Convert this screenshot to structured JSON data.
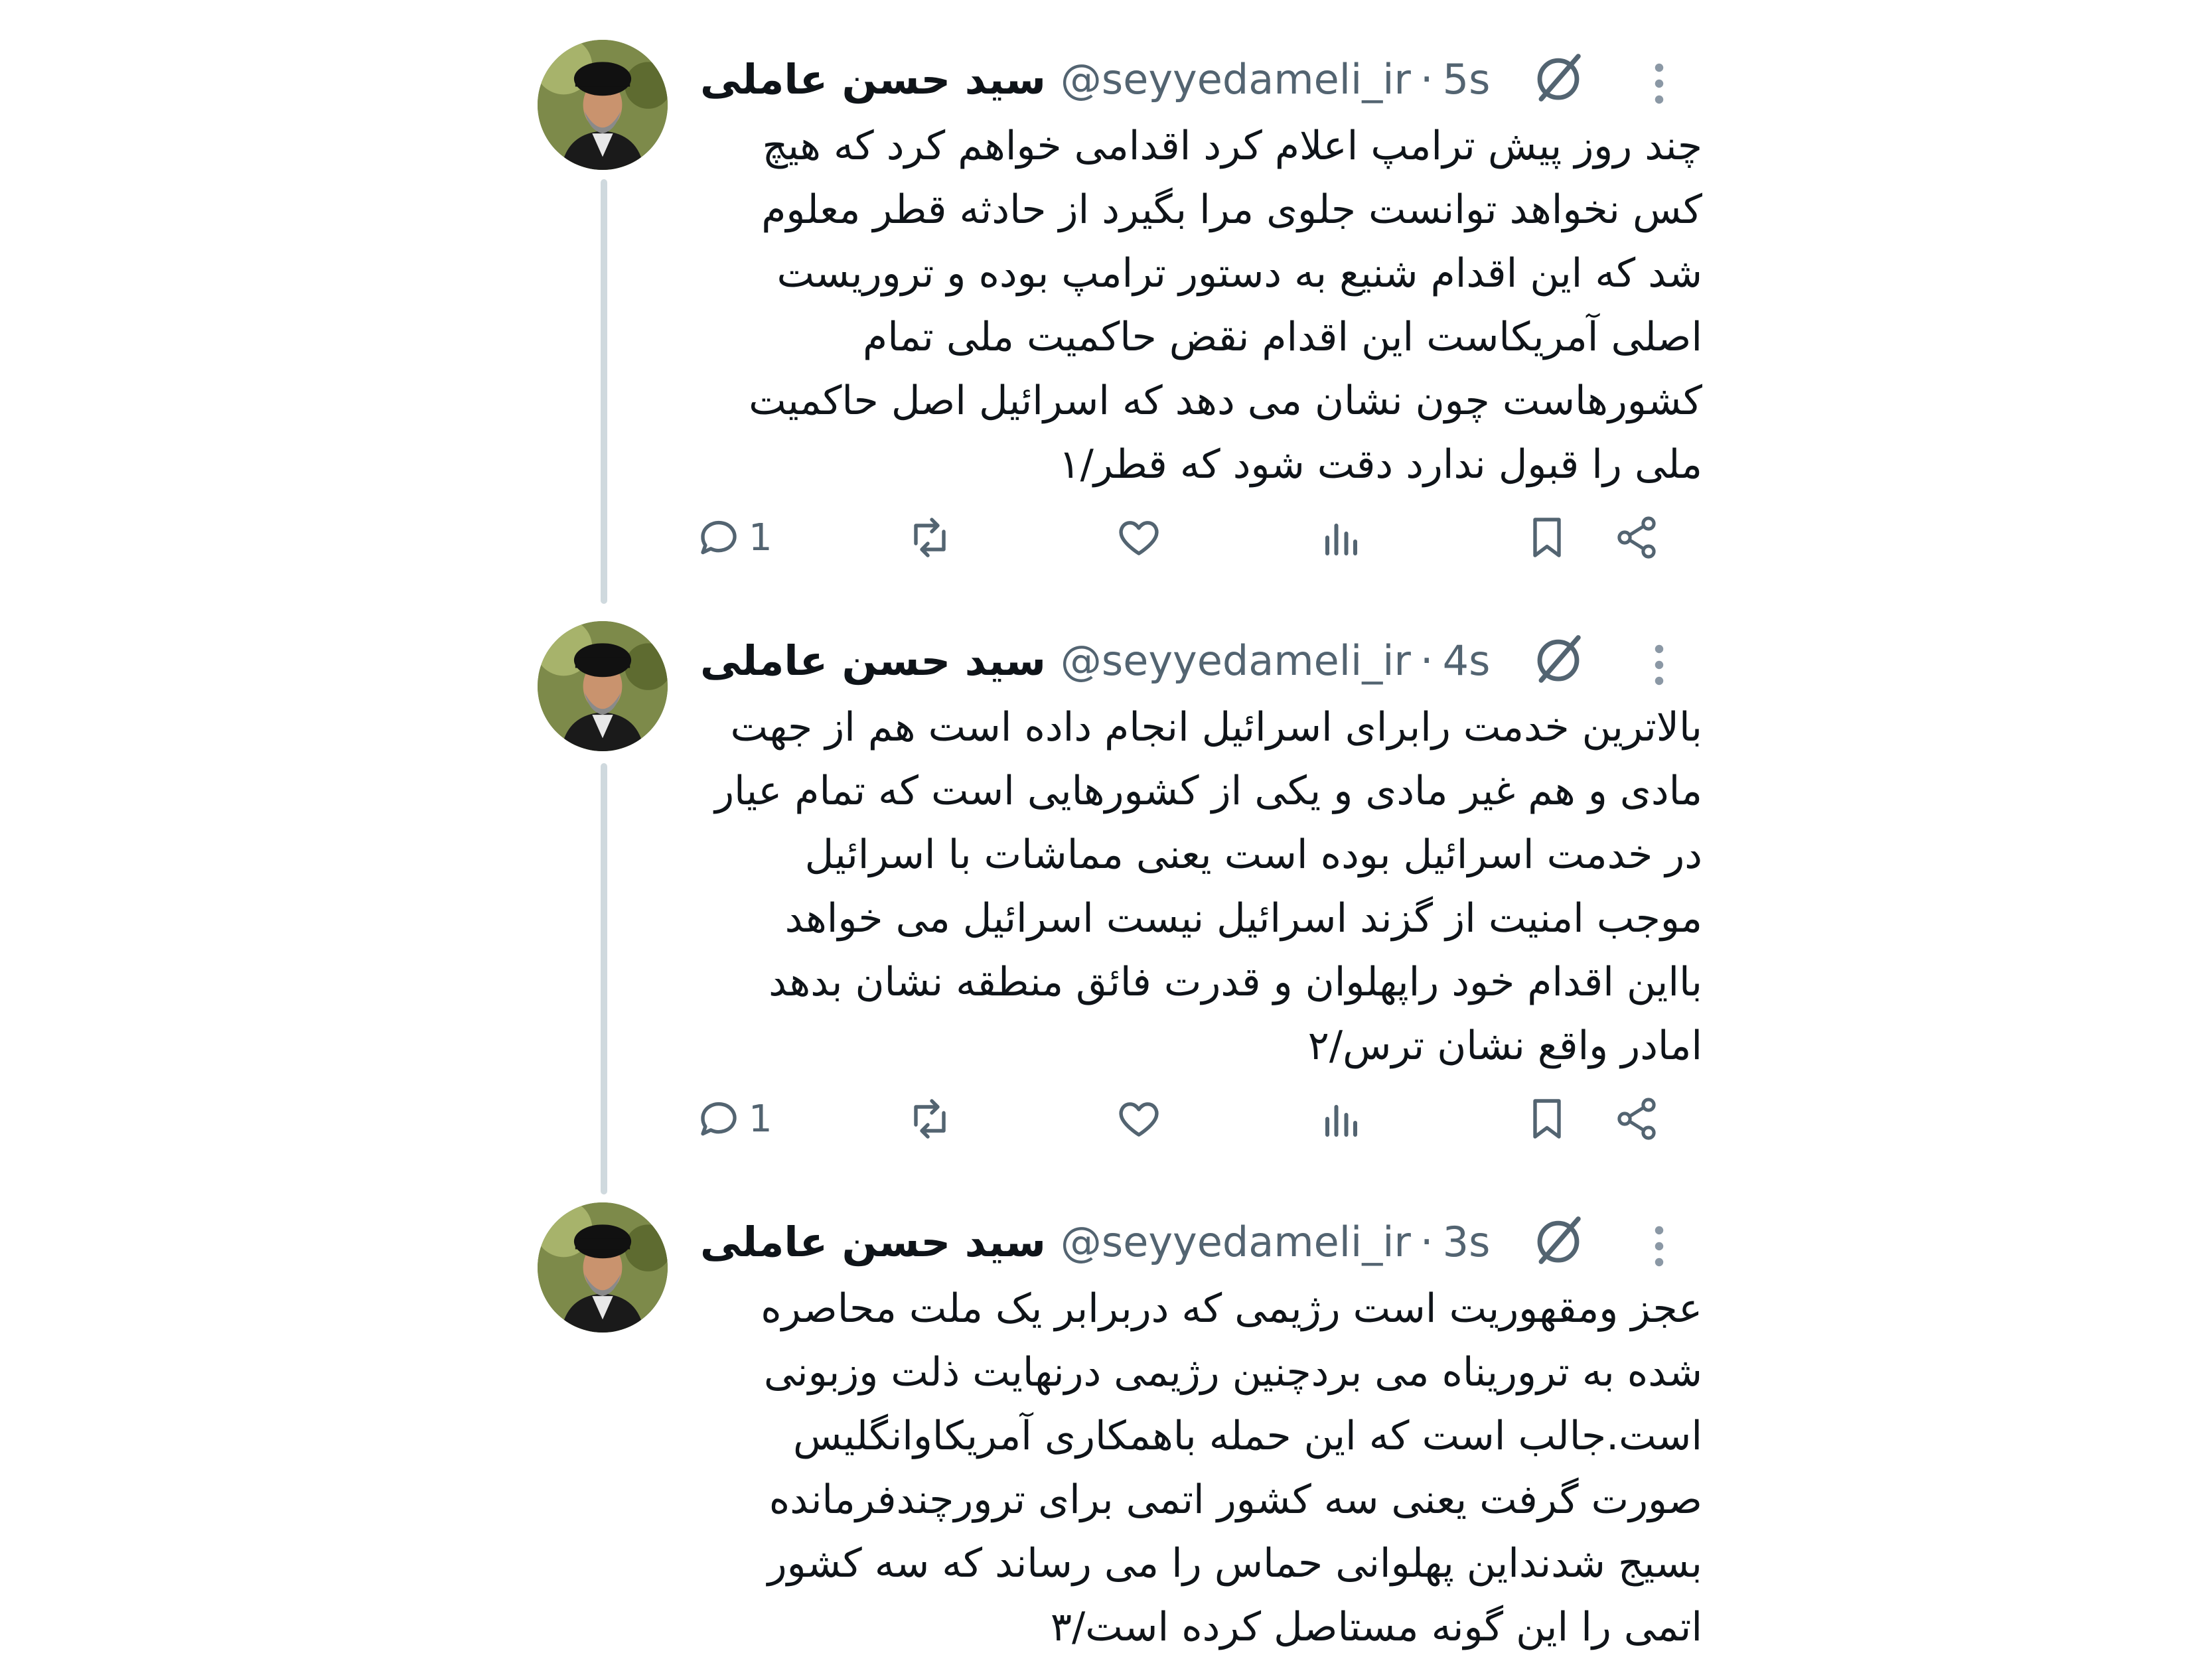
{
  "thread": {
    "tweets": [
      {
        "author_name": "سید حسن عاملی",
        "handle": "@seyyedameli_ir",
        "separator": "·",
        "time": "5s",
        "lines": [
          "چند روز پیش ترامپ اعلام کرد اقدامی خواهم کرد که هیچ",
          "کس نخواهد توانست جلوی مرا بگیرد از حادثه قطر معلوم",
          "شد که این اقدام شنیع به دستور ترامپ بوده و تروریست",
          "اصلی آمریکاست این اقدام نقض حاکمیت ملی تمام",
          "کشورهاست چون نشان می دهد که اسرائیل اصل حاکمیت",
          "ملی را قبول ندارد دقت شود که قطر/۱"
        ],
        "reply_count": "1"
      },
      {
        "author_name": "سید حسن عاملی",
        "handle": "@seyyedameli_ir",
        "separator": "·",
        "time": "4s",
        "lines": [
          "بالاترین خدمت رابرای اسرائیل انجام داده است هم از جهت",
          "مادی و هم غیر مادی و یکی از کشورهایی است که تمام عیار",
          "در خدمت اسرائیل بوده است یعنی مماشات با اسرائیل",
          "موجب امنیت از گزند اسرائیل نیست اسرائیل می خواهد",
          "بااین اقدام خود راپهلوان و قدرت فائق منطقه نشان بدهد",
          "امادر واقع نشان ترس/۲"
        ],
        "reply_count": "1"
      },
      {
        "author_name": "سید حسن عاملی",
        "handle": "@seyyedameli_ir",
        "separator": "·",
        "time": "3s",
        "lines": [
          "عجز ومقهوریت است رژیمی که دربرابر یک ملت محاصره",
          "شده به تروریناه می بردچنین رژیمی درنهایت ذلت وزبونی",
          "است.جالب است که این حمله باهمکاری آمریکاوانگلیس",
          "صورت گرفت یعنی سه کشور اتمی برای ترورچندفرمانده",
          "بسیج شدنداین پهلوانی حماس را می رساند که سه کشور",
          "اتمی را این گونه مستاصل کرده است/۳"
        ]
      }
    ]
  },
  "icons": {
    "header": [
      "grok-icon",
      "more-options-icon"
    ],
    "actions": [
      "reply-icon",
      "retweet-icon",
      "like-icon",
      "views-icon",
      "bookmark-icon",
      "share-icon"
    ],
    "avatar": "avatar-photo"
  },
  "colors": {
    "text": "#0f1419",
    "secondary": "#536471",
    "thread_line": "#cfd9de",
    "background": "#ffffff"
  }
}
